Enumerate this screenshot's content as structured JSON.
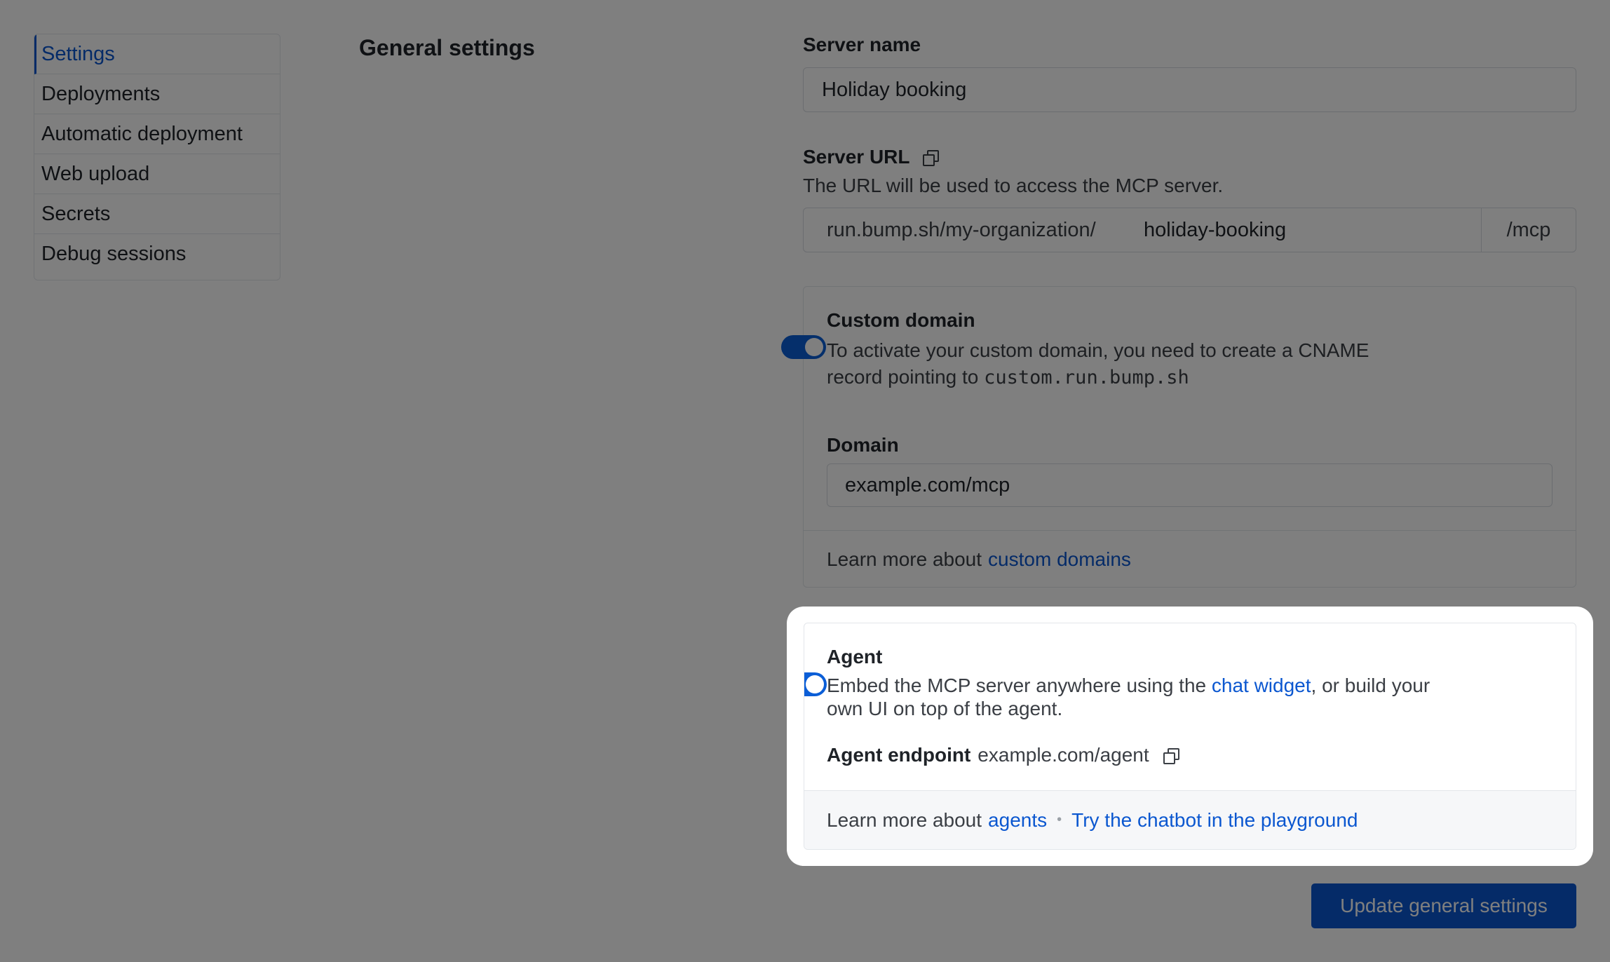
{
  "sidebar": {
    "items": [
      {
        "label": "Settings",
        "active": true
      },
      {
        "label": "Deployments"
      },
      {
        "label": "Automatic deployment"
      },
      {
        "label": "Web upload"
      },
      {
        "label": "Secrets"
      },
      {
        "label": "Debug sessions"
      }
    ]
  },
  "page_title": "General settings",
  "server_name": {
    "label": "Server name",
    "value": "Holiday booking"
  },
  "server_url": {
    "label": "Server URL",
    "help": "The URL will be used to access the MCP server.",
    "prefix": "run.bump.sh/my-organization/",
    "slug": "holiday-booking",
    "suffix": "/mcp",
    "copy_icon": "copy-icon"
  },
  "custom_domain": {
    "title": "Custom domain",
    "help_1": "To activate your custom domain, you need to create a CNAME",
    "help_2": "record pointing to",
    "cname": "custom.run.bump.sh",
    "toggle_on": true,
    "domain_label": "Domain",
    "domain_value": "example.com/mcp",
    "learn_prefix": "Learn more about",
    "learn_link": "custom domains"
  },
  "agent": {
    "title": "Agent",
    "help_before": "Embed the MCP server anywhere using the",
    "help_link": "chat widget",
    "help_after": ", or build your",
    "help_line2": "own UI on top of the agent.",
    "toggle_on": true,
    "endpoint_label": "Agent endpoint",
    "endpoint_value": "example.com/agent",
    "learn_prefix": "Learn more about",
    "learn_link": "agents",
    "separator": "•",
    "playground_link": "Try the chatbot in the playground"
  },
  "update_button": "Update general settings",
  "colors": {
    "accent": "#0b57d0",
    "toggle": "#0b5ed7",
    "overlay": "rgba(0,0,0,0.5)"
  }
}
